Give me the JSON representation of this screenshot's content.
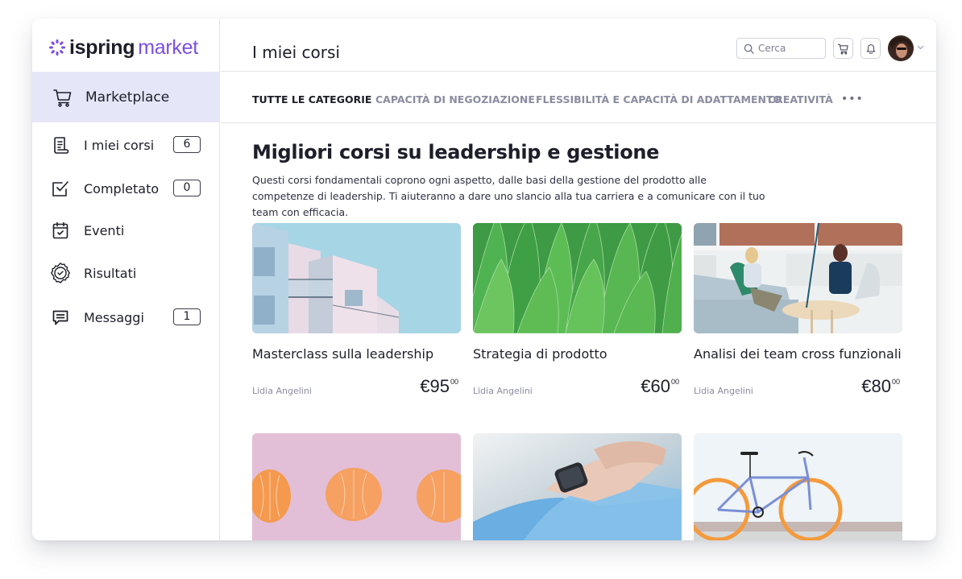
{
  "brand": {
    "name_part1": "ispring",
    "name_part2": "market",
    "accent_color": "#7b4fe0"
  },
  "sidebar": {
    "active_item": {
      "label": "Marketplace",
      "icon": "cart-icon"
    },
    "items": [
      {
        "label": "I miei corsi",
        "icon": "courses-icon",
        "badge": "6"
      },
      {
        "label": "Completato",
        "icon": "completed-icon",
        "badge": "0"
      },
      {
        "label": "Eventi",
        "icon": "calendar-icon"
      },
      {
        "label": "Risultati",
        "icon": "achievement-icon"
      },
      {
        "label": "Messaggi",
        "icon": "message-icon",
        "badge": "1"
      }
    ]
  },
  "header": {
    "title": "I miei corsi",
    "search_placeholder": "Cerca"
  },
  "tabs": [
    {
      "label": "TUTTE LE CATEGORIE",
      "active": true
    },
    {
      "label": "CAPACITÀ DI NEGOZIAZIONE",
      "active": false
    },
    {
      "label": "FLESSIBILITÀ E CAPACITÀ DI ADATTAMENTO",
      "active": false
    },
    {
      "label": "CREATIVITÀ",
      "active": false
    }
  ],
  "tabs_more": "•••",
  "section": {
    "title": "Migliori corsi su leadership e gestione",
    "description": "Questi corsi fondamentali coprono ogni aspetto, dalle basi della gestione del prodotto alle competenze di leadership. Ti aiuteranno a dare uno slancio alla tua carriera e a comunicare con il tuo team con efficacia."
  },
  "courses": [
    {
      "title": "Masterclass sulla leadership",
      "author": "Lidia Angelini",
      "price": "€95",
      "cents": "00",
      "image": "building"
    },
    {
      "title": "Strategia di prodotto",
      "author": "Lidia Angelini",
      "price": "€60",
      "cents": "00",
      "image": "leaves"
    },
    {
      "title": "Analisi dei team cross funzionali",
      "author": "Lidia Angelini",
      "price": "€80",
      "cents": "00",
      "image": "office-meeting"
    },
    {
      "image": "oranges"
    },
    {
      "image": "smartwatch"
    },
    {
      "image": "bicycle"
    }
  ]
}
